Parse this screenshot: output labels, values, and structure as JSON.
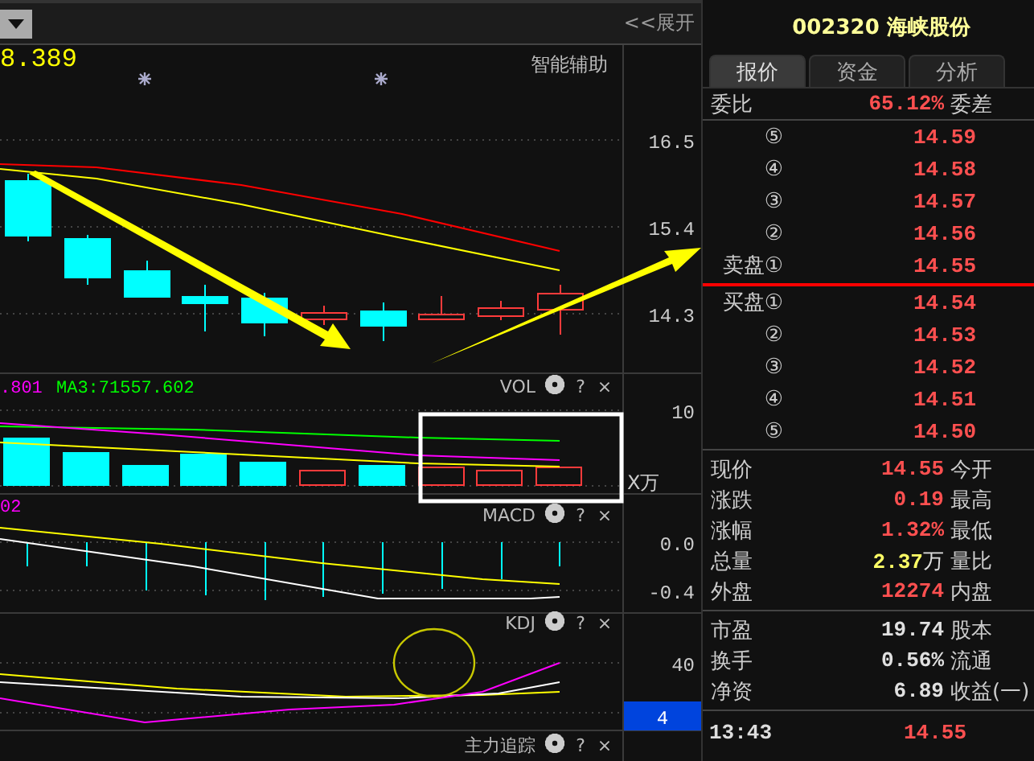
{
  "toolbar": {
    "expand_button": "<<展开"
  },
  "main_chart": {
    "indicator_value": "8.389",
    "assist_label": "智能辅助",
    "price_axis": [
      "16.5",
      "15.4",
      "14.3"
    ]
  },
  "volume_panel": {
    "legend": [
      {
        "text": ".801",
        "color": "#ff00ff"
      },
      {
        "text": "MA3:71557.602",
        "color": "#00ff00"
      }
    ],
    "title": "VOL",
    "help": "?",
    "close": "×",
    "axis": [
      "10"
    ],
    "unit": "X万"
  },
  "macd_panel": {
    "legend": [
      {
        "text": "02",
        "color": "#ff00ff"
      }
    ],
    "title": "MACD",
    "help": "?",
    "close": "×",
    "axis": [
      "0.0",
      "-0.4"
    ]
  },
  "kdj_panel": {
    "title": "KDJ",
    "help": "?",
    "close": "×",
    "axis": [
      "40"
    ],
    "badge": "4"
  },
  "tracking_panel": {
    "title": "主力追踪",
    "help": "?",
    "close": "×"
  },
  "quote": {
    "title": "002320 海峡股份",
    "tabs": [
      {
        "label": "报价",
        "selected": true
      },
      {
        "label": "资金",
        "selected": false
      },
      {
        "label": "分析",
        "selected": false
      }
    ],
    "ratio": {
      "label": "委比",
      "value": "65.12%",
      "label2": "委差"
    },
    "asks": [
      {
        "label": "⑤",
        "price": "14.59"
      },
      {
        "label": "④",
        "price": "14.58"
      },
      {
        "label": "③",
        "price": "14.57"
      },
      {
        "label": "②",
        "price": "14.56"
      },
      {
        "label": "卖盘①",
        "price": "14.55"
      }
    ],
    "bids": [
      {
        "label": "买盘①",
        "price": "14.54"
      },
      {
        "label": "②",
        "price": "14.53"
      },
      {
        "label": "③",
        "price": "14.52"
      },
      {
        "label": "④",
        "price": "14.51"
      },
      {
        "label": "⑤",
        "price": "14.50"
      }
    ],
    "stats": [
      {
        "label": "现价",
        "value": "14.55",
        "kind": "up",
        "label2": "今开"
      },
      {
        "label": "涨跌",
        "value": "0.19",
        "kind": "up",
        "label2": "最高"
      },
      {
        "label": "涨幅",
        "value": "1.32%",
        "kind": "up",
        "label2": "最低"
      },
      {
        "label": "总量",
        "value": "2.37",
        "unit": "万",
        "kind": "volume",
        "label2": "量比"
      },
      {
        "label": "外盘",
        "value": "12274",
        "kind": "up",
        "label2": "内盘"
      }
    ],
    "fundamentals": [
      {
        "label": "市盈",
        "value": "19.74",
        "kind": "plain",
        "label2": "股本"
      },
      {
        "label": "换手",
        "value": "0.56%",
        "kind": "plain",
        "label2": "流通"
      },
      {
        "label": "净资",
        "value": "6.89",
        "kind": "plain",
        "label2": "收益(一)"
      }
    ],
    "ticks": [
      {
        "time": "13:43",
        "price": "14.55"
      }
    ]
  }
}
